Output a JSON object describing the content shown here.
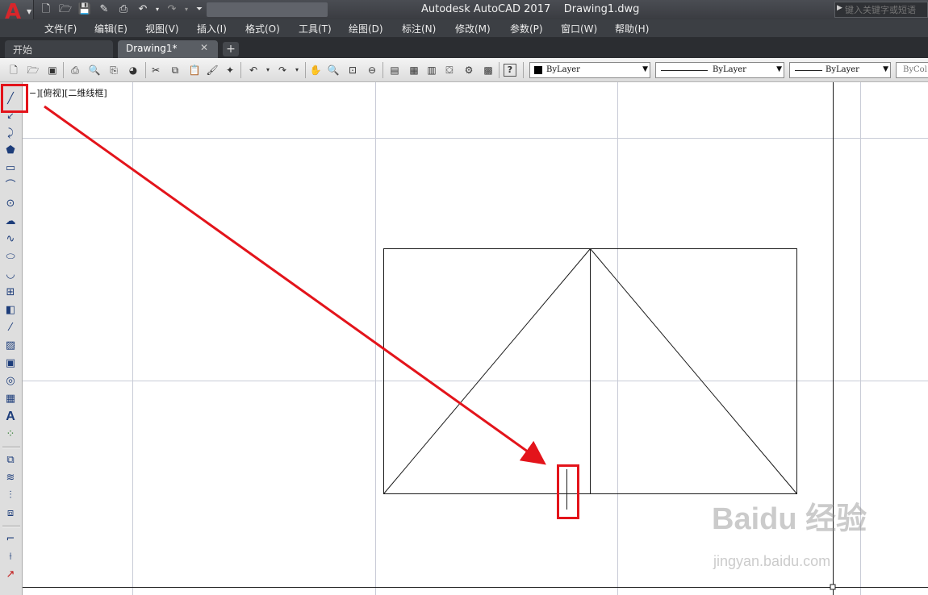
{
  "window": {
    "title": "Autodesk AutoCAD 2017    Drawing1.dwg",
    "search_placeholder": "键入关键字或短语"
  },
  "menu": [
    "文件(F)",
    "编辑(E)",
    "视图(V)",
    "插入(I)",
    "格式(O)",
    "工具(T)",
    "绘图(D)",
    "标注(N)",
    "修改(M)",
    "参数(P)",
    "窗口(W)",
    "帮助(H)"
  ],
  "tabs": {
    "start": "开始",
    "drawing": "Drawing1*",
    "close_glyph": "✕",
    "add_glyph": "+"
  },
  "properties": {
    "color": "ByLayer",
    "linetype": "ByLayer",
    "lineweight": "ByLayer",
    "plotstyle": "ByCol"
  },
  "viewport_label": "−][俯视][二维线框]",
  "left_tools": [
    "line-icon",
    "construction-line-icon",
    "polyline-icon",
    "polygon-icon",
    "rectangle-icon",
    "arc-icon",
    "circle-icon",
    "revision-cloud-icon",
    "spline-icon",
    "ellipse-icon",
    "ellipse-arc-icon",
    "insert-block-icon",
    "make-block-icon",
    "point-icon",
    "hatch-icon",
    "gradient-icon",
    "region-icon",
    "table-icon",
    "mtext-icon",
    "add-selected-icon"
  ],
  "watermark": {
    "brand": "Baidu 经验",
    "url": "jingyan.baidu.com"
  },
  "colors": {
    "highlight": "#e3141b",
    "titlebar": "#3c3f44"
  }
}
